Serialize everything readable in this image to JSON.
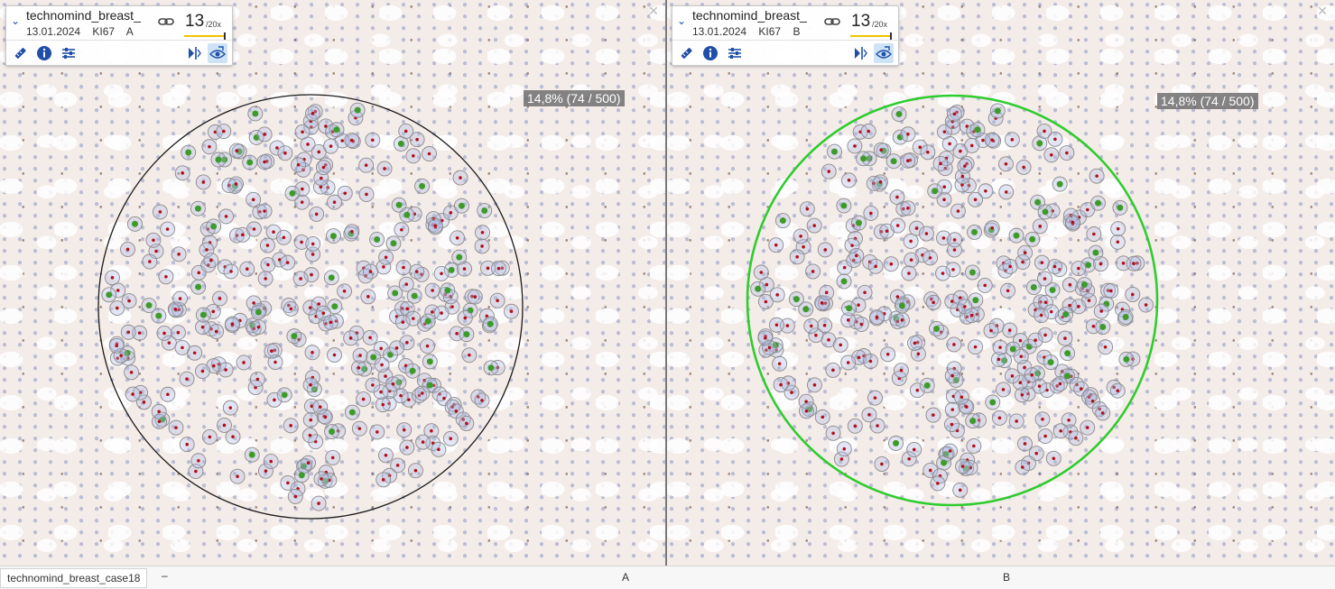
{
  "viewers": [
    {
      "id": "A",
      "slide_name": "technomind_breast_",
      "date": "13.01.2024",
      "stain": "KI67",
      "label": "A",
      "zoom_value": "13",
      "zoom_max": "/20x",
      "percentage_badge": "14,8% (74 / 500)",
      "roi_color": "#1a1a1a"
    },
    {
      "id": "B",
      "slide_name": "technomind_breast_",
      "date": "13.01.2024",
      "stain": "KI67",
      "label": "B",
      "zoom_value": "13",
      "zoom_max": "/20x",
      "percentage_badge": "14,8% (74 / 500)",
      "roi_color": "#2ecc2e"
    }
  ],
  "tools": [
    "ruler-icon",
    "info-icon",
    "settings-sliders-icon",
    "flip-icon",
    "visibility-eye-icon"
  ],
  "status_bar": {
    "case_tab": "technomind_breast_case18",
    "separator": "–",
    "pane_a_label": "A",
    "pane_b_label": "B"
  },
  "colors": {
    "accent": "#1f4fa8",
    "zoom_bar": "#f0c400",
    "negative_nucleus": "#b0101a",
    "positive_nucleus": "#3d9b2a",
    "badge_bg": "#6e6e6e"
  }
}
